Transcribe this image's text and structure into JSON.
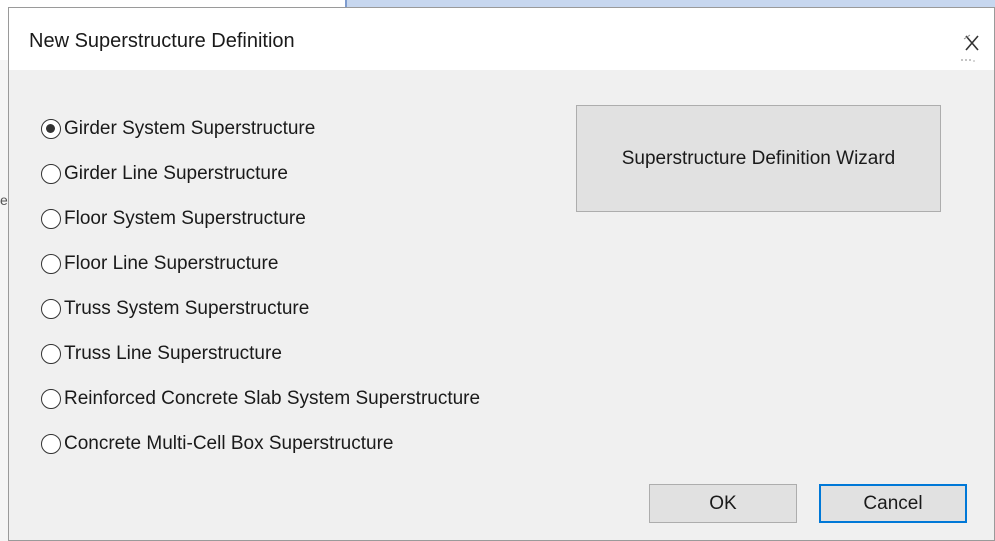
{
  "window": {
    "title": "New Superstructure Definition",
    "close_icon": "close-icon"
  },
  "options": [
    {
      "label": "Girder System Superstructure",
      "selected": true
    },
    {
      "label": "Girder Line Superstructure",
      "selected": false
    },
    {
      "label": "Floor System Superstructure",
      "selected": false
    },
    {
      "label": "Floor Line Superstructure",
      "selected": false
    },
    {
      "label": "Truss System Superstructure",
      "selected": false
    },
    {
      "label": "Truss Line Superstructure",
      "selected": false
    },
    {
      "label": "Reinforced Concrete Slab System Superstructure",
      "selected": false
    },
    {
      "label": "Concrete Multi-Cell Box Superstructure",
      "selected": false
    }
  ],
  "buttons": {
    "wizard_label": "Superstructure Definition Wizard",
    "ok_label": "OK",
    "cancel_label": "Cancel"
  },
  "background": {
    "left_glyph": "e"
  },
  "colors": {
    "dialog_bg": "#f0f0f0",
    "button_bg": "#e1e1e1",
    "focus_border": "#0078d7"
  }
}
